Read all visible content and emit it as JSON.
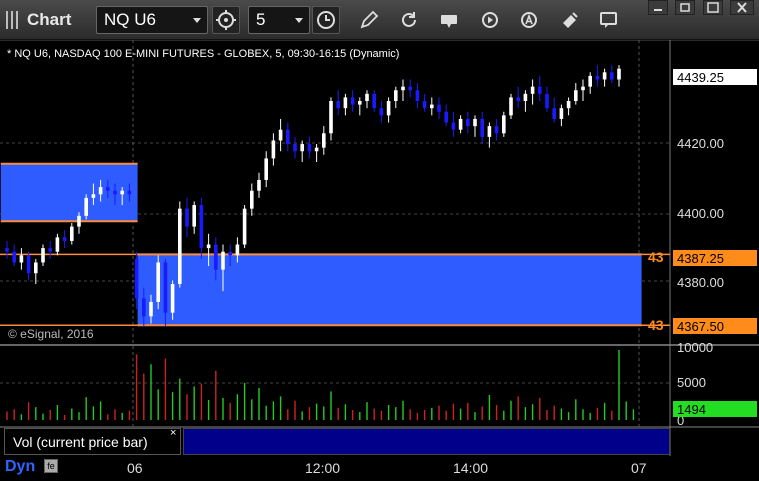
{
  "window": {
    "title": "Chart"
  },
  "toolbar": {
    "symbol": "NQ U6",
    "interval": "5",
    "icons": [
      "symbol-link-icon",
      "interval-clock-icon",
      "draw-pencil-icon",
      "refresh-icon",
      "get-data-icon",
      "play-icon",
      "alert-icon",
      "cursor-tool-icon",
      "comment-icon"
    ]
  },
  "chart": {
    "title": "* NQ U6, NASDAQ 100 E-MINI FUTURES - GLOBEX, 5, 09:30-16:15 (Dynamic)",
    "copyright": "© eSignal, 2016",
    "current_price": "4439.25",
    "level_high": "4387.25",
    "level_low": "4367.50",
    "level_prefix": "43",
    "colors": {
      "up": "#ffffff",
      "down": "#1a1aff",
      "zone": "#2f5cff",
      "zone_border": "#ff8c3a",
      "vol_up": "#22cc22",
      "vol_down": "#cc2222"
    }
  },
  "volume": {
    "legend": "Vol (current price bar)",
    "close_glyph": "×",
    "current_value": "1494"
  },
  "bottom": {
    "label": "Dyn"
  },
  "chart_data": {
    "type": "candlestick",
    "title": "* NQ U6, NASDAQ 100 E-MINI FUTURES - GLOBEX, 5, 09:30-16:15 (Dynamic)",
    "y_axis": {
      "ticks": [
        "4439.25",
        "4420.00",
        "4400.00",
        "4387.25",
        "4380.00",
        "4367.50"
      ],
      "ylim": [
        4362,
        4447
      ]
    },
    "volume_axis": {
      "ticks": [
        "10000",
        "5000",
        "0"
      ],
      "ylim": [
        0,
        10500
      ]
    },
    "x_axis": {
      "ticks": [
        "06",
        "12:00",
        "14:00",
        "07"
      ]
    },
    "zones": [
      {
        "start_bar": -1,
        "end_bar": 18,
        "high": 4412.5,
        "low": 4396.5
      },
      {
        "start_bar": 18,
        "end_bar": 88,
        "high": 4387.25,
        "low": 4367.5
      }
    ],
    "candles": [
      [
        4389,
        4391,
        4386,
        4388
      ],
      [
        4388,
        4390,
        4384,
        4385
      ],
      [
        4385,
        4389,
        4383,
        4387
      ],
      [
        4387,
        4388,
        4380,
        4382
      ],
      [
        4382,
        4386,
        4379,
        4385
      ],
      [
        4385,
        4390,
        4384,
        4389
      ],
      [
        4389,
        4391,
        4386,
        4388
      ],
      [
        4388,
        4393,
        4387,
        4392
      ],
      [
        4392,
        4394,
        4389,
        4391
      ],
      [
        4391,
        4396,
        4390,
        4395
      ],
      [
        4395,
        4399,
        4393,
        4398
      ],
      [
        4398,
        4404,
        4397,
        4403
      ],
      [
        4403,
        4407,
        4401,
        4404
      ],
      [
        4404,
        4408,
        4402,
        4406
      ],
      [
        4406,
        4408,
        4403,
        4405
      ],
      [
        4405,
        4407,
        4401,
        4404
      ],
      [
        4404,
        4406,
        4401,
        4405
      ],
      [
        4405,
        4407,
        4402,
        4404
      ],
      [
        4386,
        4388,
        4372,
        4375
      ],
      [
        4375,
        4378,
        4367,
        4370
      ],
      [
        4370,
        4376,
        4368,
        4374
      ],
      [
        4374,
        4387,
        4372,
        4385
      ],
      [
        4385,
        4386,
        4367,
        4371
      ],
      [
        4371,
        4380,
        4369,
        4379
      ],
      [
        4379,
        4402,
        4378,
        4400
      ],
      [
        4400,
        4403,
        4392,
        4395
      ],
      [
        4395,
        4402,
        4393,
        4401
      ],
      [
        4401,
        4403,
        4386,
        4389
      ],
      [
        4389,
        4393,
        4384,
        4390
      ],
      [
        4390,
        4392,
        4380,
        4383
      ],
      [
        4383,
        4390,
        4377,
        4388
      ],
      [
        4388,
        4390,
        4384,
        4387
      ],
      [
        4387,
        4392,
        4385,
        4390
      ],
      [
        4390,
        4401,
        4389,
        4400
      ],
      [
        4400,
        4407,
        4398,
        4405
      ],
      [
        4405,
        4410,
        4403,
        4408
      ],
      [
        4408,
        4416,
        4406,
        4414
      ],
      [
        4414,
        4421,
        4412,
        4419
      ],
      [
        4419,
        4425,
        4416,
        4422
      ],
      [
        4422,
        4424,
        4416,
        4418
      ],
      [
        4418,
        4420,
        4414,
        4416
      ],
      [
        4416,
        4419,
        4413,
        4418
      ],
      [
        4418,
        4420,
        4414,
        4416
      ],
      [
        4416,
        4418,
        4413,
        4417
      ],
      [
        4417,
        4423,
        4415,
        4421
      ],
      [
        4421,
        4431,
        4419,
        4430
      ],
      [
        4430,
        4433,
        4426,
        4428
      ],
      [
        4428,
        4432,
        4426,
        4431
      ],
      [
        4431,
        4433,
        4427,
        4429
      ],
      [
        4429,
        4431,
        4426,
        4430
      ],
      [
        4430,
        4433,
        4428,
        4432
      ],
      [
        4432,
        4433,
        4427,
        4428
      ],
      [
        4428,
        4430,
        4424,
        4426
      ],
      [
        4426,
        4431,
        4424,
        4430
      ],
      [
        4430,
        4434,
        4428,
        4433
      ],
      [
        4433,
        4436,
        4430,
        4434
      ],
      [
        4434,
        4436,
        4431,
        4433
      ],
      [
        4433,
        4435,
        4428,
        4430
      ],
      [
        4430,
        4432,
        4427,
        4428
      ],
      [
        4428,
        4431,
        4426,
        4429
      ],
      [
        4429,
        4431,
        4425,
        4427
      ],
      [
        4427,
        4429,
        4423,
        4424
      ],
      [
        4424,
        4427,
        4420,
        4422
      ],
      [
        4422,
        4426,
        4421,
        4425
      ],
      [
        4425,
        4427,
        4421,
        4423
      ],
      [
        4423,
        4426,
        4420,
        4425
      ],
      [
        4425,
        4427,
        4418,
        4420
      ],
      [
        4420,
        4424,
        4417,
        4423
      ],
      [
        4423,
        4425,
        4419,
        4421
      ],
      [
        4421,
        4427,
        4420,
        4426
      ],
      [
        4426,
        4432,
        4425,
        4431
      ],
      [
        4431,
        4434,
        4428,
        4430
      ],
      [
        4430,
        4433,
        4427,
        4432
      ],
      [
        4432,
        4436,
        4429,
        4434
      ],
      [
        4434,
        4437,
        4430,
        4432
      ],
      [
        4432,
        4434,
        4427,
        4428
      ],
      [
        4428,
        4431,
        4424,
        4425
      ],
      [
        4425,
        4429,
        4423,
        4428
      ],
      [
        4428,
        4431,
        4426,
        4430
      ],
      [
        4430,
        4435,
        4429,
        4433
      ],
      [
        4433,
        4436,
        4430,
        4434
      ],
      [
        4434,
        4438,
        4432,
        4437
      ],
      [
        4437,
        4440,
        4434,
        4436
      ],
      [
        4436,
        4439,
        4434,
        4438
      ],
      [
        4438,
        4440,
        4435,
        4436
      ],
      [
        4436,
        4440,
        4434,
        4439
      ]
    ],
    "volumes": [
      1200,
      1500,
      800,
      2500,
      1800,
      900,
      1400,
      2100,
      700,
      1600,
      1100,
      3200,
      1900,
      2600,
      800,
      1500,
      1000,
      1300,
      9200,
      6500,
      7800,
      4300,
      8600,
      3900,
      5800,
      3600,
      4700,
      5100,
      2800,
      6900,
      3100,
      2400,
      3600,
      5200,
      2900,
      4500,
      2000,
      2600,
      3300,
      1500,
      2700,
      1200,
      1800,
      2300,
      1900,
      4000,
      1700,
      2200,
      1400,
      1100,
      2500,
      1600,
      1300,
      2100,
      1800,
      2700,
      1500,
      1000,
      1400,
      1700,
      2000,
      1300,
      2300,
      1600,
      2400,
      1100,
      1900,
      3500,
      2100,
      1300,
      2700,
      3300,
      1800,
      2200,
      3100,
      1400,
      2000,
      1600,
      1100,
      2900,
      1500,
      1000,
      1700,
      2400,
      1300,
      9800,
      2600,
      1494
    ],
    "series": [
      {
        "name": "Vol (current price bar)"
      }
    ]
  }
}
